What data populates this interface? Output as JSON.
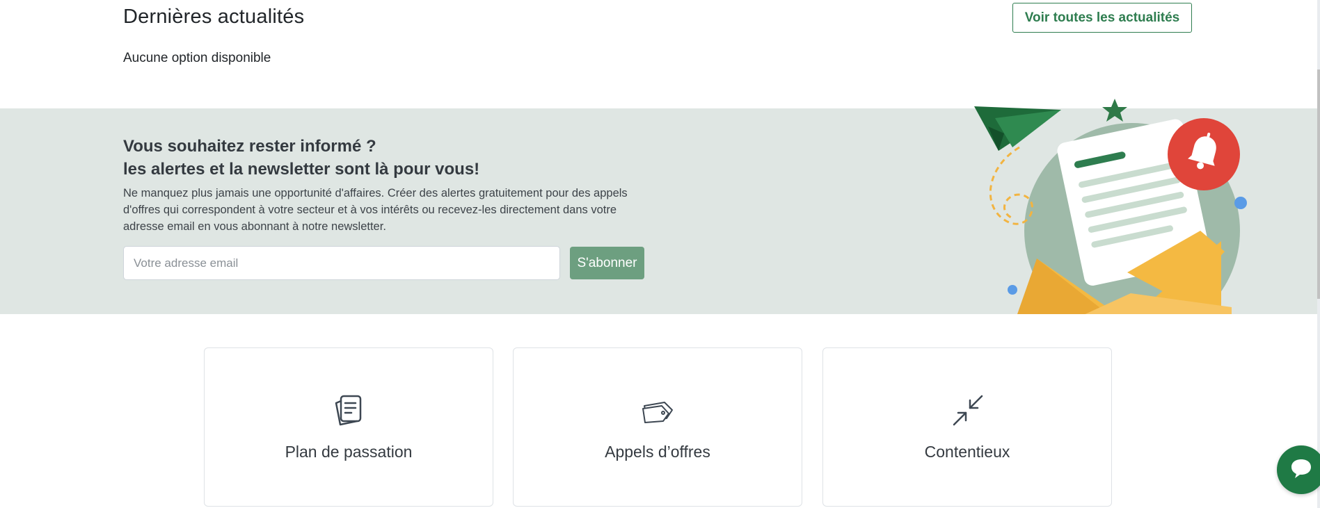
{
  "news": {
    "title": "Dernières actualités",
    "view_all_label": "Voir toutes les actualités",
    "empty_text": "Aucune option disponible"
  },
  "newsletter": {
    "heading_line1": "Vous souhaitez rester informé ?",
    "heading_line2": "les alertes et la newsletter sont là pour vous!",
    "description": "Ne manquez plus jamais une opportunité d'affaires. Créer des alertes gratuitement pour des appels d'offres qui correspondent à votre secteur et à vos intérêts ou recevez-les directement dans votre adresse email en vous abonnant à notre newsletter.",
    "email_placeholder": "Votre adresse email",
    "email_value": "",
    "subscribe_label": "S'abonner",
    "illustration_icons": [
      "paper-plane-icon",
      "star-icon",
      "bell-icon",
      "envelope-icon"
    ]
  },
  "cards": [
    {
      "label": "Plan de passation",
      "icon": "documents-icon"
    },
    {
      "label": "Appels d’offres",
      "icon": "tags-icon"
    },
    {
      "label": "Contentieux",
      "icon": "collapse-arrows-icon"
    }
  ],
  "chat": {
    "icon": "chat-icon"
  },
  "colors": {
    "brand_green": "#2e7d4f",
    "subscribe_button": "#6d9f80",
    "band_background": "#dfe6e3",
    "bell_red": "#e0453a",
    "envelope_yellow": "#f4b942",
    "chat_green": "#1f7a45"
  }
}
